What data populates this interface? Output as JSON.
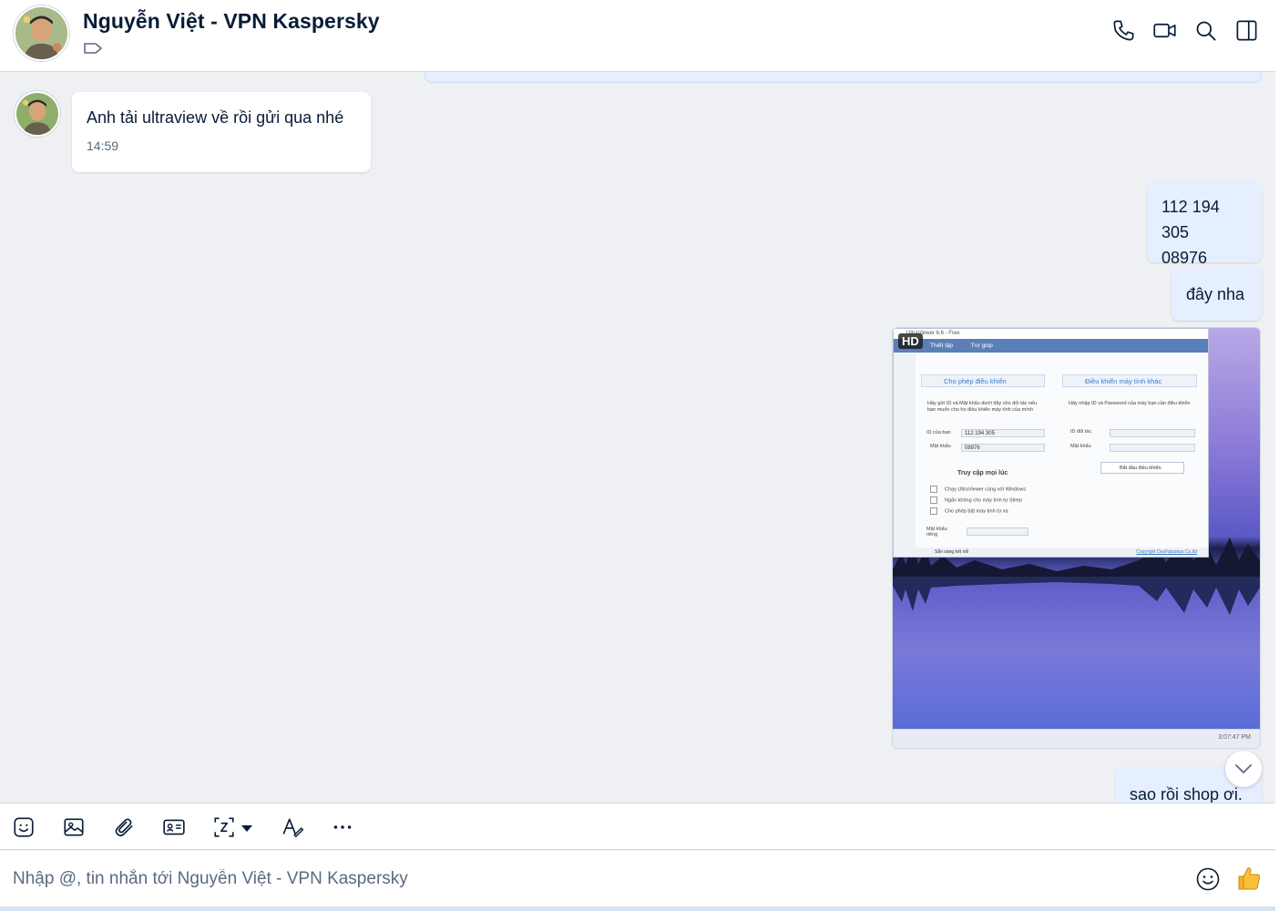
{
  "header": {
    "title": "Nguyễn Việt - VPN Kaspersky",
    "icons": [
      "phone-icon",
      "video-call-icon",
      "search-icon",
      "side-panel-icon"
    ]
  },
  "messages": {
    "incoming_text": "Anh tải ultraview về rồi gửi qua nhé",
    "incoming_time": "14:59",
    "out1_line1": "112 194 305",
    "out1_line2": "08976",
    "out2": "đây nha",
    "out3": "sao rồi shop ơi."
  },
  "image_message": {
    "badge": "HD",
    "ultraviewer": {
      "titlebar": "UltraViewer 6.6 - Free",
      "menu": [
        "Thiết lập",
        "Trợ giúp"
      ],
      "panel_left": "Cho phép điều khiển",
      "panel_right": "Điều khiển máy tính khác",
      "desc_left": "Hãy gửi ID và Mật khẩu dưới đây cho đối tác nếu bạn muốn cho họ điều khiển máy tính của mình",
      "desc_right": "Hãy nhập ID và Password của máy bạn cần điều khiển",
      "id_label": "ID của bạn",
      "id_value": "112 194 305",
      "pw_label": "Mật khẩu",
      "pw_value": "08976",
      "partner_label": "ID đối tác",
      "partner_pw_label": "Mật khẩu",
      "start_button": "Bắt đầu điều khiển",
      "section": "Truy cập mọi lúc",
      "options": [
        "Chạy UltraViewer cùng với Windows",
        "Ngăn không cho máy tính tự Sleep",
        "Cho phép bật máy tính từ xa"
      ],
      "private_pw_label": "Mật khẩu riêng",
      "status": "Sẵn sàng kết nối",
      "copyright": "Copyright DucFabulous Co,ltd"
    },
    "taskbar_time": "3:07:47 PM"
  },
  "toolbar": {
    "icons": [
      "sticker-icon",
      "image-icon",
      "attachment-icon",
      "contact-card-icon",
      "screenshot-icon",
      "dropdown-caret-icon",
      "text-format-icon",
      "more-icon"
    ]
  },
  "composer": {
    "placeholder": "Nhập @, tin nhắn tới Nguyễn Việt - VPN Kaspersky",
    "value": "",
    "emoji_icon": "emoji-icon",
    "like_icon": "thumbs-up-icon"
  },
  "colors": {
    "accent": "#0068ff",
    "outgoing_bubble": "#e5efff",
    "incoming_bubble": "#ffffff",
    "chat_bg": "#eef0f3"
  }
}
